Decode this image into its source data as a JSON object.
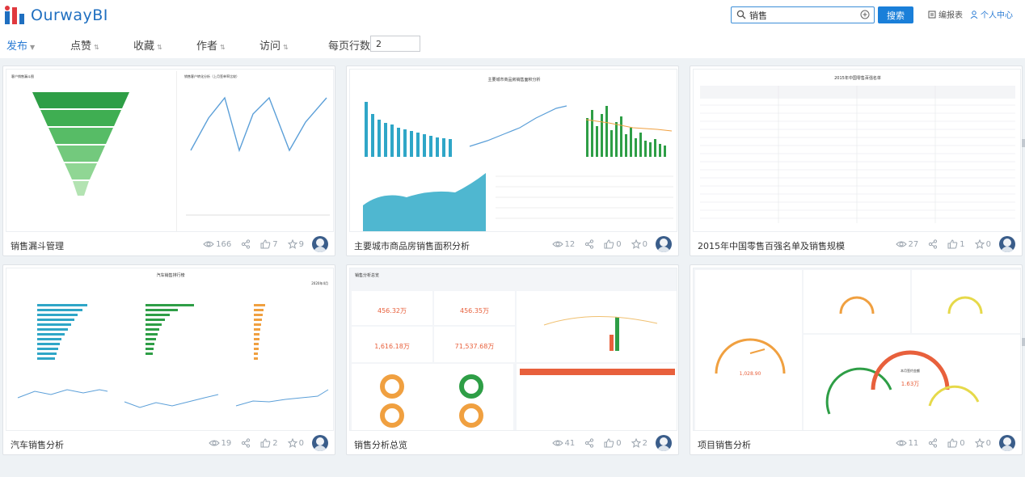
{
  "brand": {
    "name": "OurwayBI"
  },
  "header": {
    "search_value": "销售",
    "search_button": "搜索",
    "edit_link": "编报表",
    "user_link": "个人中心"
  },
  "filters": {
    "items": [
      "发布",
      "点赞",
      "收藏",
      "作者",
      "访问"
    ],
    "rows_label": "每页行数",
    "rows_value": "2"
  },
  "cards": [
    {
      "title": "销售漏斗管理",
      "views": "166",
      "likes": "7",
      "favorites": "9"
    },
    {
      "title": "主要城市商品房销售面积分析",
      "views": "12",
      "likes": "0",
      "favorites": "0"
    },
    {
      "title": "2015年中国零售百强名单及销售规模",
      "views": "27",
      "likes": "1",
      "favorites": "0"
    },
    {
      "title": "汽车销售分析",
      "views": "19",
      "likes": "2",
      "favorites": "0"
    },
    {
      "title": "销售分析总览",
      "views": "41",
      "likes": "0",
      "favorites": "2"
    },
    {
      "title": "项目销售分析",
      "views": "11",
      "likes": "0",
      "favorites": "0"
    }
  ],
  "thumbnails": {
    "funnel": {
      "title": "客户销售漏斗图",
      "line_title": "销售客户转化分析（上月签单率比较）"
    },
    "city": {
      "title": "主要城市商品房销售面积分析"
    },
    "retail": {
      "title": "2015年中国零售百强名单"
    },
    "auto": {
      "title": "汽车销售排行榜",
      "date": "2020年4月"
    },
    "overview": {
      "title": "销售分析总览",
      "kpis": [
        "456.32万",
        "456.35万",
        "1,616.18万",
        "71,537.68万"
      ]
    },
    "project": {
      "gauge_value": "1,028.90",
      "value2": "1.63万",
      "center_label": "本月签约金额"
    }
  },
  "colors": {
    "accent": "#1a7fd9",
    "green": "#2e9e46",
    "teal": "#2fa6c7",
    "orange": "#f0a040"
  }
}
